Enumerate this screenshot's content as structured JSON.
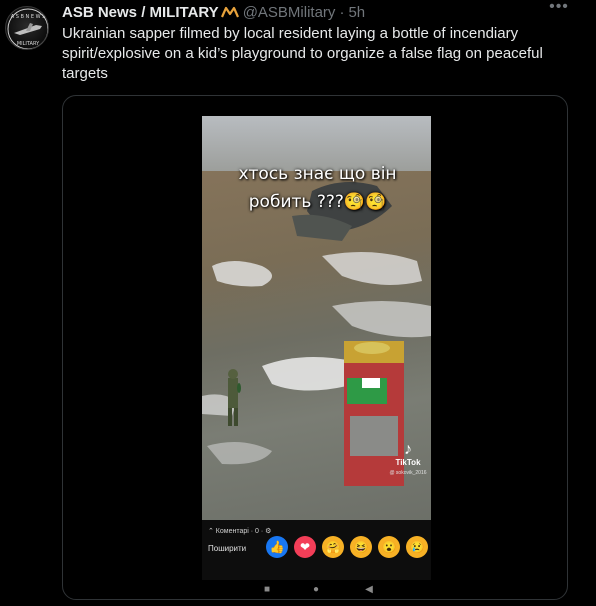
{
  "tweet": {
    "author_name": "ASB News / MILITARY",
    "author_handle": "@ASBMilitary",
    "separator": "·",
    "time": "5h",
    "more_icon": "•••",
    "text": "Ukrainian sapper filmed by local resident laying a bottle of incendiary spirit/explosive on a kid’s playground to organize a false flag on peaceful targets"
  },
  "video": {
    "overlay_text_line1": "хтось знає що він",
    "overlay_text_line2": "робить ???🧐🧐",
    "tiktok_label": "TikTok",
    "tiktok_user": "@ sokovik_2016",
    "comments_label": "⌃ Коментарі · 0 · ⚙",
    "share_label": "Поширити",
    "reactions": [
      "👍",
      "❤",
      "🤗",
      "😆",
      "😮",
      "😢"
    ]
  },
  "nav": {
    "back_icon": "◀",
    "home_icon": "●",
    "recents_icon": "■"
  },
  "colors": {
    "background": "#000000",
    "primary_text": "#e7e9ea",
    "secondary_text": "#71767b",
    "border": "#2f3336",
    "badge": "#e8a33c"
  }
}
